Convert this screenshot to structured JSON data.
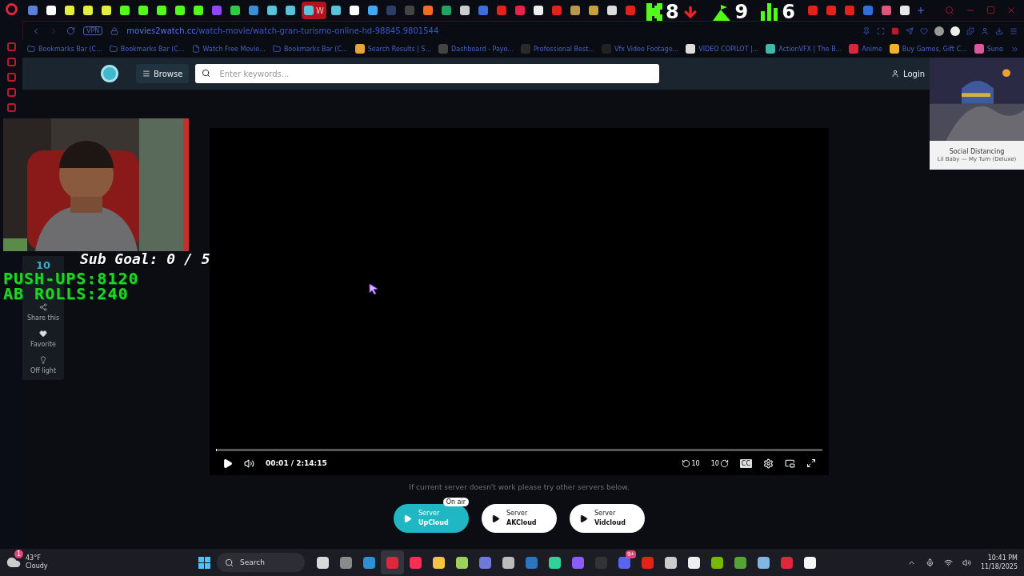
{
  "browser": {
    "tabs": [
      {
        "color": "#5b7fd6",
        "selected": false
      },
      {
        "color": "#ffffff",
        "selected": false
      },
      {
        "color": "#e4ef3a",
        "selected": false
      },
      {
        "color": "#e4ef3a",
        "selected": false
      },
      {
        "color": "#e4ef3a",
        "selected": false
      },
      {
        "color": "#53fc18",
        "selected": false
      },
      {
        "color": "#53fc18",
        "selected": false
      },
      {
        "color": "#53fc18",
        "selected": false
      },
      {
        "color": "#53fc18",
        "selected": false
      },
      {
        "color": "#53fc18",
        "selected": false
      },
      {
        "color": "#9146ff",
        "selected": false
      },
      {
        "color": "#2ecc40",
        "selected": false
      },
      {
        "color": "#3a8fd6",
        "selected": false
      },
      {
        "color": "#58c4dc",
        "selected": false
      },
      {
        "color": "#58c4dc",
        "selected": false
      },
      {
        "color": "#58c4dc",
        "selected": true,
        "letter": "W"
      },
      {
        "color": "#58c4dc",
        "selected": false
      },
      {
        "color": "#ffffff",
        "selected": false
      },
      {
        "color": "#3fa9f5",
        "selected": false
      },
      {
        "color": "#2c3e66",
        "selected": false
      },
      {
        "color": "#444444",
        "selected": false
      },
      {
        "color": "#f26b21",
        "selected": false
      },
      {
        "color": "#1fa463",
        "selected": false
      },
      {
        "color": "#cccccc",
        "selected": false
      },
      {
        "color": "#3b6fe0",
        "selected": false
      },
      {
        "color": "#e62117",
        "selected": false
      },
      {
        "color": "#e8224a",
        "selected": false
      },
      {
        "color": "#eeeeee",
        "selected": false
      },
      {
        "color": "#e62117",
        "selected": false
      },
      {
        "color": "#b8964a",
        "selected": false
      },
      {
        "color": "#c9a13b",
        "selected": false
      },
      {
        "color": "#dddddd",
        "selected": false
      },
      {
        "color": "#e62117",
        "selected": false
      },
      {
        "color": "#e62117",
        "selected": false
      },
      {
        "color": "#e62117",
        "selected": false
      },
      {
        "color": "#e62117",
        "selected": false
      },
      {
        "color": "#2f6fdb",
        "selected": false
      },
      {
        "color": "#e0557a",
        "selected": false
      },
      {
        "color": "#e8e8e8",
        "selected": false
      }
    ],
    "address": {
      "vpn": "VPN",
      "domain": "movies2watch.cc",
      "path": "/watch-movie/watch-gran-turismo-online-hd-98845.9801544"
    },
    "bookmarks": [
      {
        "kind": "folder",
        "label": "Bookmarks Bar (C..."
      },
      {
        "kind": "folder",
        "label": "Bookmarks Bar (C..."
      },
      {
        "kind": "page",
        "label": "Watch Free Movie..."
      },
      {
        "kind": "folder",
        "label": "Bookmarks Bar (C..."
      },
      {
        "kind": "site",
        "color": "#e8a33b",
        "label": "Search Results | S..."
      },
      {
        "kind": "site",
        "color": "#444444",
        "label": "Dashboard - Payo..."
      },
      {
        "kind": "site",
        "color": "#2a2a2a",
        "label": "Professional Best..."
      },
      {
        "kind": "site",
        "color": "#222222",
        "label": "Vfx Video Footage..."
      },
      {
        "kind": "site",
        "color": "#dddddd",
        "label": "VIDEO COPILOT |..."
      },
      {
        "kind": "site",
        "color": "#3fb8a8",
        "label": "ActionVFX | The B..."
      },
      {
        "kind": "site",
        "color": "#d8263a",
        "label": "Anime"
      },
      {
        "kind": "site",
        "color": "#f0b030",
        "label": "Buy Games, Gift C..."
      },
      {
        "kind": "site",
        "color": "#d85a9a",
        "label": "Suno"
      }
    ]
  },
  "site": {
    "browse": "Browse",
    "search_placeholder": "Enter keywords...",
    "login": "Login"
  },
  "share_panel": {
    "count": "10",
    "items": [
      {
        "kind": "share",
        "label": "Share this"
      },
      {
        "kind": "heart",
        "label": "Favorite"
      },
      {
        "kind": "bulb",
        "label": "Off light"
      }
    ]
  },
  "player": {
    "progress": {
      "level": 0.001
    },
    "time": "00:01",
    "separator": "/",
    "duration": "2:14:15",
    "rewind": "10",
    "forward": "10",
    "cc": "CC"
  },
  "server_note": "If current server doesn't work please try other servers below.",
  "servers": [
    {
      "label": "Server",
      "name": "UpCloud",
      "selected": true,
      "badge": "On air"
    },
    {
      "label": "Server",
      "name": "AKCloud",
      "selected": false
    },
    {
      "label": "Server",
      "name": "Vidcloud",
      "selected": false
    }
  ],
  "stream_overlay": {
    "sub_goal": "Sub Goal: 0 / 5",
    "pushups": "PUSH-UPS:8120",
    "ab_rolls": "AB ROLLS:240",
    "counters": [
      {
        "kind": "kick",
        "value": "8"
      },
      {
        "kind": "flag",
        "value": "9"
      },
      {
        "kind": "bars",
        "value": "6"
      }
    ]
  },
  "music_widget": {
    "title": "Social Distancing",
    "artist": "Lil Baby — My Turn (Deluxe)"
  },
  "taskbar": {
    "weather": {
      "badge": "1",
      "temp": "43°F",
      "condition": "Cloudy"
    },
    "search": "Search",
    "apps": [
      {
        "color": "#d9d9d9"
      },
      {
        "color": "#8a8a8a"
      },
      {
        "color": "#2d8fd5"
      },
      {
        "color": "#e0263a",
        "selected": true
      },
      {
        "color": "#fa2d55"
      },
      {
        "color": "#f5c242"
      },
      {
        "color": "#9bd35a"
      },
      {
        "color": "#6f7ad8"
      },
      {
        "color": "#bbbbbb"
      },
      {
        "color": "#2a75bb"
      },
      {
        "color": "#2fd39a"
      },
      {
        "color": "#8b5cf6"
      },
      {
        "color": "#333333"
      },
      {
        "color": "#5865f2",
        "badge": "9+"
      },
      {
        "color": "#e62117"
      },
      {
        "color": "#cccccc"
      },
      {
        "color": "#eeeeee"
      },
      {
        "color": "#76b900"
      },
      {
        "color": "#52a535"
      },
      {
        "color": "#7fb6e6"
      },
      {
        "color": "#e0263a"
      },
      {
        "color": "#f5f5f5"
      }
    ],
    "time": "10:41 PM",
    "date": "11/18/2025"
  }
}
